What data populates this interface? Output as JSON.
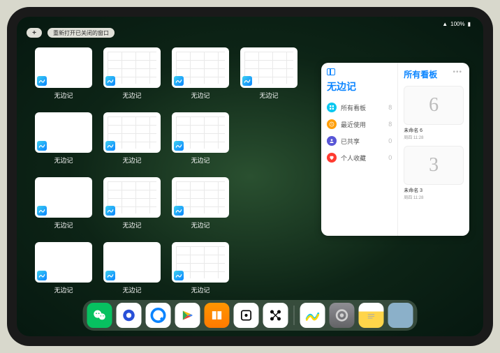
{
  "status": {
    "battery": "100%",
    "wifi": "􀙇"
  },
  "topbar": {
    "plus": "+",
    "reopen_label": "重新打开已关闭的窗口"
  },
  "switcher": {
    "app_label": "无边记",
    "windows": [
      {
        "style": "blank"
      },
      {
        "style": "grid"
      },
      {
        "style": "grid"
      },
      {
        "style": "grid"
      },
      {
        "style": "blank"
      },
      {
        "style": "grid"
      },
      {
        "style": "grid"
      },
      {
        "placeholder": true
      },
      {
        "style": "blank"
      },
      {
        "style": "grid"
      },
      {
        "style": "grid"
      },
      {
        "placeholder": true
      },
      {
        "style": "blank"
      },
      {
        "style": "blank"
      },
      {
        "style": "grid"
      }
    ]
  },
  "panel": {
    "title": "无边记",
    "right_title": "所有看板",
    "items": [
      {
        "label": "所有看板",
        "count": "8",
        "color": "#0ac8f0",
        "icon": "grid"
      },
      {
        "label": "最近使用",
        "count": "8",
        "color": "#ff9f0a",
        "icon": "clock"
      },
      {
        "label": "已共享",
        "count": "0",
        "color": "#5856d6",
        "icon": "person"
      },
      {
        "label": "个人收藏",
        "count": "0",
        "color": "#ff3b30",
        "icon": "heart"
      }
    ],
    "boards": [
      {
        "glyph": "6",
        "name": "未命名 6",
        "date": "周四 11:28"
      },
      {
        "glyph": "3",
        "name": "未命名 3",
        "date": "周四 11:28"
      }
    ]
  },
  "dock": {
    "items": [
      {
        "name": "wechat",
        "cls": "wechat"
      },
      {
        "name": "quark-hd",
        "cls": "blue1"
      },
      {
        "name": "quark",
        "cls": "blue2"
      },
      {
        "name": "play-store",
        "cls": "play"
      },
      {
        "name": "books",
        "cls": "books"
      },
      {
        "name": "dice",
        "cls": "dice"
      },
      {
        "name": "graph",
        "cls": "nodes"
      },
      {
        "name": "sep"
      },
      {
        "name": "freeform",
        "cls": "freeform"
      },
      {
        "name": "settings",
        "cls": "settings"
      },
      {
        "name": "notes",
        "cls": "notes"
      },
      {
        "name": "recent-apps",
        "cls": "multi"
      }
    ]
  }
}
